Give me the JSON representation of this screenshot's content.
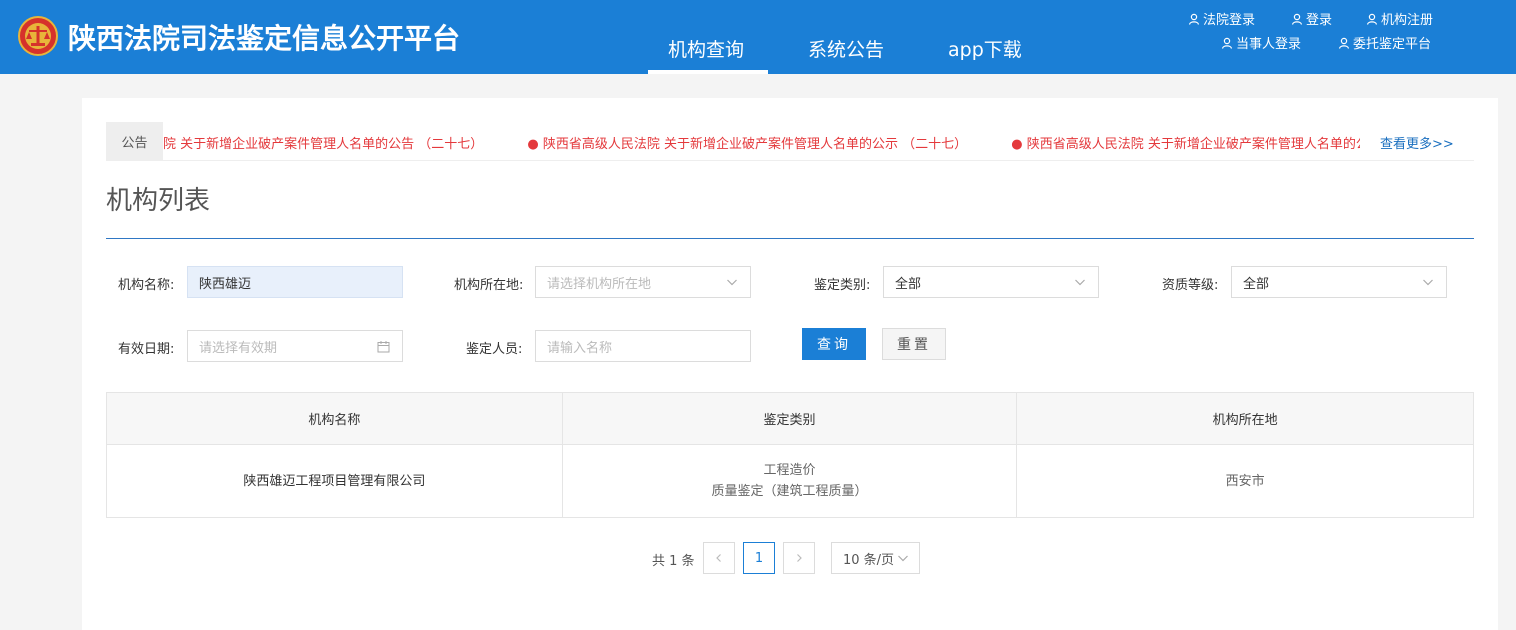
{
  "header": {
    "site_title": "陕西法院司法鉴定信息公开平台",
    "nav": [
      "机构查询",
      "系统公告",
      "app下载"
    ],
    "active_nav": "机构查询",
    "top_links_row1": [
      "法院登录",
      "登录",
      "机构注册"
    ],
    "top_links_row2": [
      "当事人登录",
      "委托鉴定平台"
    ],
    "brand_color": "#1b7fd6"
  },
  "notice": {
    "tag": "公告",
    "items": [
      "院 关于新增企业破产案件管理人名单的公告 （二十七）",
      "● 陕西省高级人民法院 关于新增企业破产案件管理人名单的公示 （二十七）",
      "● 陕西省高级人民法院 关于新增企业破产案件管理人名单的公告"
    ],
    "more": "查看更多>>",
    "color": "#e4393c"
  },
  "section_title": "机构列表",
  "form": {
    "name_label": "机构名称:",
    "name_value": "陕西雄迈",
    "location_label": "机构所在地:",
    "location_placeholder": "请选择机构所在地",
    "category_label": "鉴定类别:",
    "category_value": "全部",
    "level_label": "资质等级:",
    "level_value": "全部",
    "date_label": "有效日期:",
    "date_placeholder": "请选择有效期",
    "person_label": "鉴定人员:",
    "person_placeholder": "请输入名称",
    "query_button": "查询",
    "reset_button": "重置"
  },
  "table": {
    "headers": [
      "机构名称",
      "鉴定类别",
      "机构所在地"
    ],
    "rows": [
      {
        "name": "陕西雄迈工程项目管理有限公司",
        "category_line1": "工程造价",
        "category_line2": "质量鉴定（建筑工程质量）",
        "location": "西安市"
      }
    ]
  },
  "pagination": {
    "total": "共 1 条",
    "current_page": "1",
    "page_size": "10 条/页"
  },
  "icons": [
    "court-emblem-icon",
    "user-icon",
    "chevron-down-icon",
    "calendar-icon",
    "chevron-left-icon",
    "chevron-right-icon"
  ]
}
